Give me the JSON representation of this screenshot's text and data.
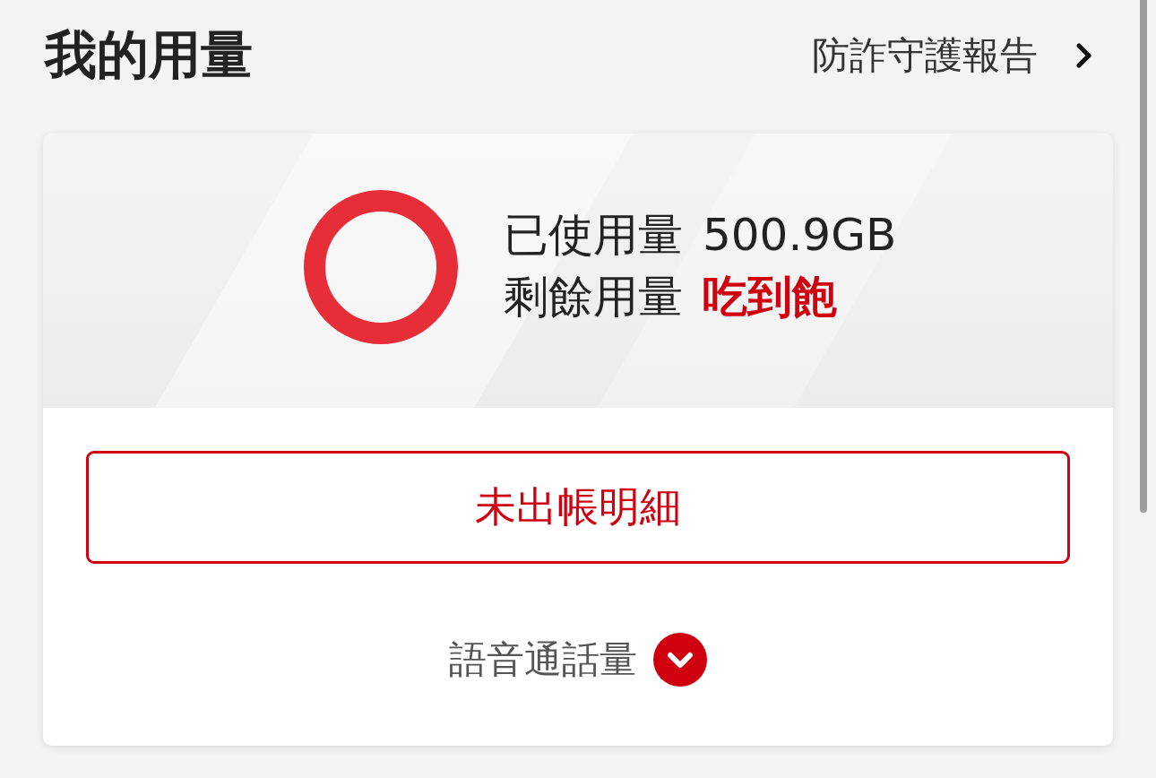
{
  "header": {
    "title": "我的用量",
    "report_link": "防詐守護報告"
  },
  "usage": {
    "used_label": "已使用量",
    "used_value": "500.9GB",
    "remaining_label": "剩餘用量",
    "remaining_value": "吃到飽"
  },
  "unbilled_button": "未出帳明細",
  "voice_usage": {
    "label": "語音通話量",
    "expanded": false
  }
}
